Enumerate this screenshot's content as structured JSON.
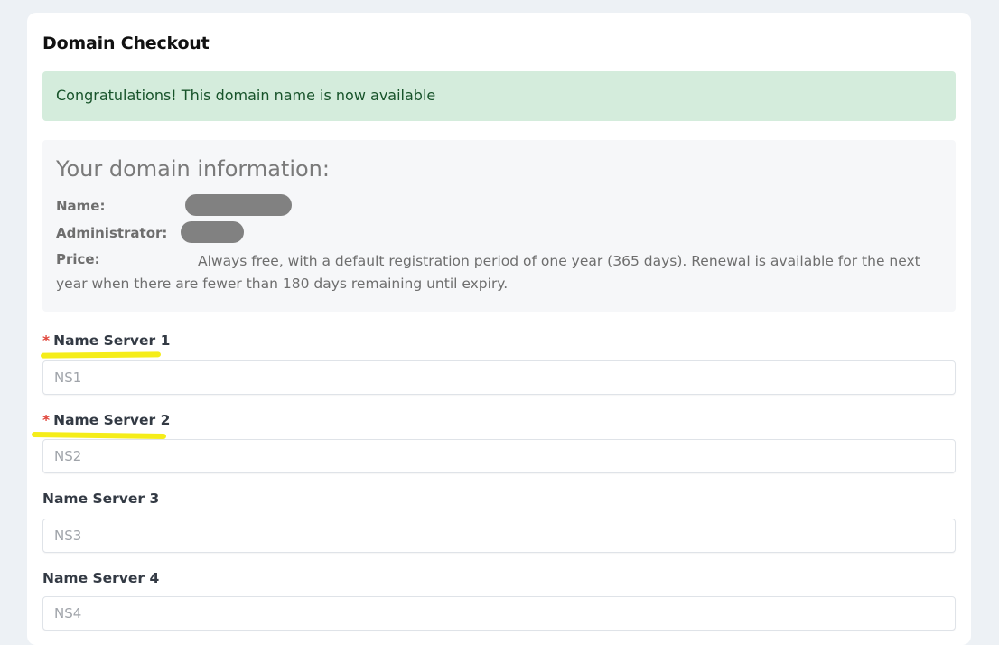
{
  "title": "Domain Checkout",
  "alert": {
    "text": "Congratulations! This domain name is now available",
    "color": "#d4ecdc"
  },
  "info": {
    "heading": "Your domain information:",
    "name_label": "Name:",
    "admin_label": "Administrator:",
    "price_label": "Price:",
    "price_text": "Always free, with a default registration period of one year (365 days). Renewal is available for the next year when there are fewer than 180 days remaining until expiry."
  },
  "fields": [
    {
      "label": "Name Server 1",
      "placeholder": "NS1",
      "value": ""
    },
    {
      "label": "Name Server 2",
      "placeholder": "NS2",
      "value": ""
    },
    {
      "label": "Name Server 3",
      "placeholder": "NS3",
      "value": ""
    },
    {
      "label": "Name Server 4",
      "placeholder": "NS4",
      "value": ""
    }
  ],
  "required_mark": "*",
  "colors": {
    "accent_required": "#e0443a",
    "highlight": "#f5ed1a",
    "background": "#edf1f5"
  }
}
